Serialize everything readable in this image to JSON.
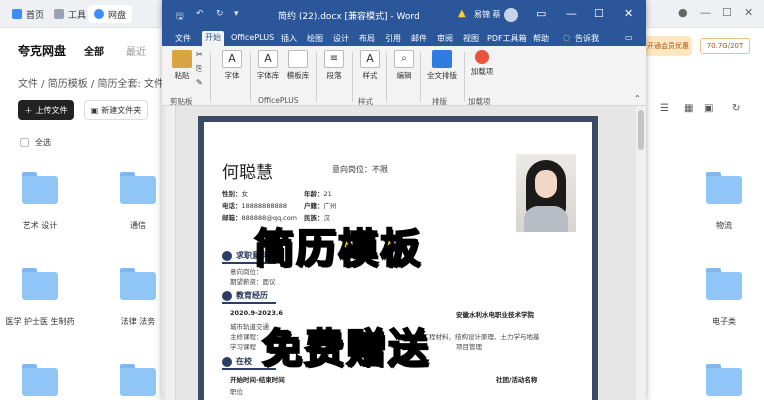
{
  "quark": {
    "tabs": [
      {
        "label": "首页"
      },
      {
        "label": "工具"
      },
      {
        "label": "网盘"
      }
    ],
    "brand": "夸克网盘",
    "nav": {
      "all": "全部",
      "recent": "最近"
    },
    "breadcrumb": "文件 / 简历模板 / 简历全套: 文件",
    "upload_button": "上传文件",
    "new_folder_button": "新建文件夹",
    "select_all": "全选",
    "vip_badge": "开通会员优惠",
    "storage": "70.7G/20T",
    "folders": [
      {
        "label": "艺术 设计"
      },
      {
        "label": "通信"
      },
      {
        "label": ""
      },
      {
        "label": "物流"
      },
      {
        "label": "医学 护士医 生制药"
      },
      {
        "label": "法律 法务"
      },
      {
        "label": ""
      },
      {
        "label": "电子类"
      },
      {
        "label": ""
      },
      {
        "label": ""
      },
      {
        "label": ""
      },
      {
        "label": ""
      }
    ]
  },
  "word": {
    "title": "简约 (22).docx [兼容模式] - Word",
    "user": "易锦 蔡",
    "tabs": [
      "文件",
      "开始",
      "OfficePLUS",
      "插入",
      "绘图",
      "设计",
      "布局",
      "引用",
      "邮件",
      "审阅",
      "视图",
      "PDF工具箱",
      "帮助",
      "告诉我"
    ],
    "active_tab": "开始",
    "ribbon": {
      "paste": "粘贴",
      "font": "字体",
      "font_lib": "字体库",
      "template_lib": "模板库",
      "paragraph": "段落",
      "style": "样式",
      "edit": "编辑",
      "full_layout": "全文排版",
      "load_item": "加载项",
      "groups": {
        "clipboard": "剪贴板",
        "officeplus": "OfficePLUS",
        "style": "样式",
        "layout": "排版",
        "addins": "加载项"
      }
    }
  },
  "resume": {
    "name": "何聪慧",
    "intent_label": "意向岗位：不限",
    "info_left": [
      {
        "k": "性别：",
        "v": "女"
      },
      {
        "k": "电话：",
        "v": "18888888888"
      },
      {
        "k": "邮箱：",
        "v": "888888@qq.com"
      }
    ],
    "info_right": [
      {
        "k": "年龄：",
        "v": "21"
      },
      {
        "k": "户籍：",
        "v": "广州"
      },
      {
        "k": "民族：",
        "v": "汉"
      }
    ],
    "section_job": "求职意向",
    "job_lines": [
      "意向岗位：",
      "期望薪资：面议"
    ],
    "section_edu": "教育经历",
    "edu_period": "2020.9-2023.6",
    "edu_school": "安徽水利水电职业技术学院",
    "edu_line1": "城市轨道交通",
    "edu_line2": "主修课程：",
    "edu_line2b": "水工程材料、结构设计原理、土力学与地基",
    "edu_line3": "学习课程",
    "edu_line3b": "项目管理",
    "section_campus": "在校",
    "campus_start": "开始时间-结束时间",
    "campus_org": "社团/活动名称",
    "campus_role": "职位"
  },
  "overlay": {
    "line1": "简历模板",
    "line2": "免费赠送"
  }
}
